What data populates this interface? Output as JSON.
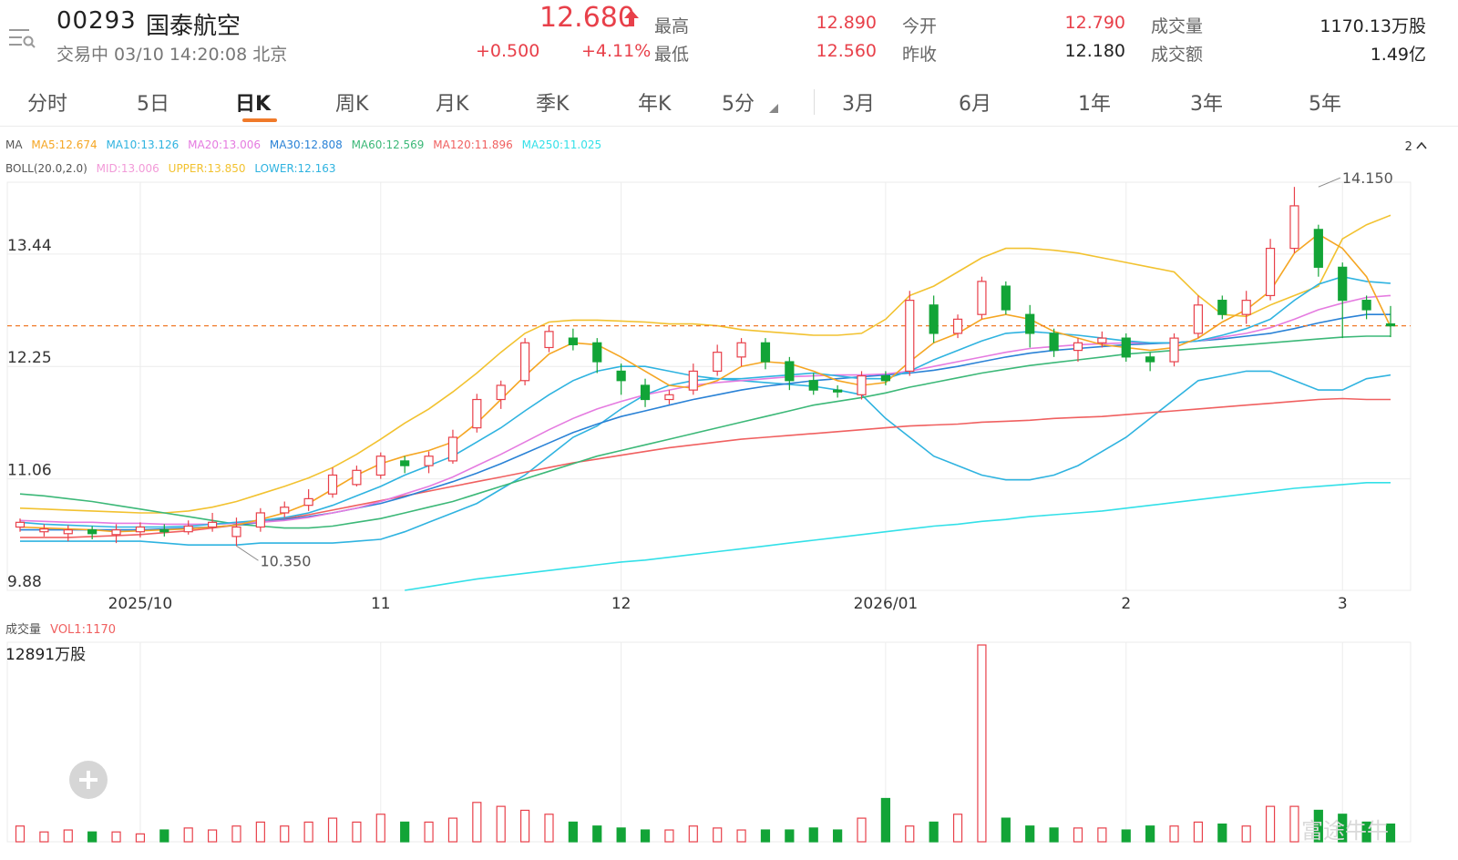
{
  "header": {
    "code": "00293",
    "name": "国泰航空",
    "status": "交易中 03/10 14:20:08 北京",
    "price": "12.680",
    "change": "+0.500",
    "change_pct": "+4.11%",
    "stats": [
      {
        "label": "最高",
        "value": "12.890",
        "color": "red"
      },
      {
        "label": "最低",
        "value": "12.560",
        "color": "red"
      },
      {
        "label": "今开",
        "value": "12.790",
        "color": "red"
      },
      {
        "label": "昨收",
        "value": "12.180",
        "color": "dark"
      },
      {
        "label": "成交量",
        "value": "1170.13万股",
        "color": "dark"
      },
      {
        "label": "成交额",
        "value": "1.49亿",
        "color": "dark"
      }
    ]
  },
  "tabs": [
    "分时",
    "5日",
    "日K",
    "周K",
    "月K",
    "季K",
    "年K",
    "5分",
    "3月",
    "6月",
    "1年",
    "3年",
    "5年"
  ],
  "active_tab": "日K",
  "ma_legend": {
    "prefix": "MA",
    "items": [
      {
        "text": "MA5:12.674",
        "color": "#f5a623"
      },
      {
        "text": "MA10:13.126",
        "color": "#2fb3e0"
      },
      {
        "text": "MA20:13.006",
        "color": "#e57be0"
      },
      {
        "text": "MA30:12.808",
        "color": "#2a82d6"
      },
      {
        "text": "MA60:12.569",
        "color": "#3cb878"
      },
      {
        "text": "MA120:11.896",
        "color": "#f06060"
      },
      {
        "text": "MA250:11.025",
        "color": "#33e0e8"
      }
    ]
  },
  "boll_legend": {
    "prefix": "BOLL(20.0,2.0)",
    "items": [
      {
        "text": "MID:13.006",
        "color": "#f29ad8"
      },
      {
        "text": "UPPER:13.850",
        "color": "#f2c230"
      },
      {
        "text": "LOWER:12.163",
        "color": "#2fb3e0"
      }
    ]
  },
  "collapse_label": "2",
  "vol_legend": {
    "label": "成交量",
    "value": "VOL1:1170"
  },
  "vol_max_label": "12891万股",
  "watermark": "富途牛牛",
  "colors": {
    "up": "#e8404a",
    "down": "#12a437",
    "accent": "#f07a2a"
  },
  "chart_data": {
    "type": "candlestick",
    "y_ticks": [
      "13.44",
      "12.25",
      "11.06",
      "9.88"
    ],
    "ylim": [
      9.88,
      14.2
    ],
    "x_ticks": [
      {
        "label": "2025/10",
        "index": 5
      },
      {
        "label": "11",
        "index": 15
      },
      {
        "label": "12",
        "index": 25
      },
      {
        "label": "2026/01",
        "index": 36
      },
      {
        "label": "2",
        "index": 46
      },
      {
        "label": "3",
        "index": 55
      }
    ],
    "current_price": 12.68,
    "high_annotation": {
      "label": "14.150",
      "index": 54,
      "value": 14.15
    },
    "low_annotation": {
      "label": "10.350",
      "index": 9,
      "value": 10.35
    },
    "candles": [
      [
        10.55,
        10.6,
        10.64,
        10.5
      ],
      [
        10.5,
        10.53,
        10.58,
        10.45
      ],
      [
        10.48,
        10.52,
        10.57,
        10.4
      ],
      [
        10.52,
        10.48,
        10.56,
        10.42
      ],
      [
        10.47,
        10.52,
        10.58,
        10.38
      ],
      [
        10.5,
        10.55,
        10.6,
        10.44
      ],
      [
        10.52,
        10.5,
        10.58,
        10.45
      ],
      [
        10.5,
        10.56,
        10.62,
        10.47
      ],
      [
        10.55,
        10.6,
        10.7,
        10.5
      ],
      [
        10.45,
        10.55,
        10.65,
        10.35
      ],
      [
        10.55,
        10.7,
        10.75,
        10.5
      ],
      [
        10.7,
        10.76,
        10.82,
        10.65
      ],
      [
        10.78,
        10.85,
        10.95,
        10.72
      ],
      [
        10.9,
        11.1,
        11.18,
        10.86
      ],
      [
        11.0,
        11.15,
        11.2,
        10.98
      ],
      [
        11.1,
        11.3,
        11.34,
        11.06
      ],
      [
        11.25,
        11.2,
        11.3,
        11.12
      ],
      [
        11.2,
        11.3,
        11.35,
        11.12
      ],
      [
        11.25,
        11.5,
        11.58,
        11.22
      ],
      [
        11.6,
        11.9,
        11.96,
        11.55
      ],
      [
        11.9,
        12.05,
        12.1,
        11.8
      ],
      [
        12.1,
        12.5,
        12.55,
        12.05
      ],
      [
        12.45,
        12.62,
        12.68,
        12.4
      ],
      [
        12.55,
        12.48,
        12.65,
        12.42
      ],
      [
        12.5,
        12.3,
        12.55,
        12.18
      ],
      [
        12.2,
        12.1,
        12.28,
        11.95
      ],
      [
        12.05,
        11.9,
        12.12,
        11.82
      ],
      [
        11.9,
        11.95,
        12.0,
        11.85
      ],
      [
        12.0,
        12.2,
        12.28,
        11.95
      ],
      [
        12.2,
        12.4,
        12.48,
        12.15
      ],
      [
        12.35,
        12.5,
        12.55,
        12.25
      ],
      [
        12.5,
        12.3,
        12.55,
        12.22
      ],
      [
        12.3,
        12.1,
        12.35,
        12.0
      ],
      [
        12.1,
        12.0,
        12.18,
        11.95
      ],
      [
        12.0,
        11.98,
        12.05,
        11.92
      ],
      [
        11.95,
        12.15,
        12.2,
        11.9
      ],
      [
        12.15,
        12.1,
        12.2,
        12.05
      ],
      [
        12.2,
        12.95,
        13.05,
        12.15
      ],
      [
        12.9,
        12.6,
        13.0,
        12.5
      ],
      [
        12.6,
        12.75,
        12.8,
        12.55
      ],
      [
        12.8,
        13.15,
        13.2,
        12.75
      ],
      [
        13.1,
        12.85,
        13.15,
        12.8
      ],
      [
        12.8,
        12.6,
        12.9,
        12.45
      ],
      [
        12.6,
        12.42,
        12.65,
        12.35
      ],
      [
        12.42,
        12.5,
        12.55,
        12.3
      ],
      [
        12.5,
        12.55,
        12.62,
        12.45
      ],
      [
        12.55,
        12.35,
        12.6,
        12.3
      ],
      [
        12.35,
        12.3,
        12.4,
        12.2
      ],
      [
        12.3,
        12.55,
        12.6,
        12.25
      ],
      [
        12.6,
        12.9,
        13.0,
        12.55
      ],
      [
        12.95,
        12.8,
        13.0,
        12.75
      ],
      [
        12.8,
        12.95,
        13.05,
        12.7
      ],
      [
        13.0,
        13.5,
        13.6,
        12.95
      ],
      [
        13.5,
        13.95,
        14.15,
        13.45
      ],
      [
        13.7,
        13.3,
        13.75,
        13.2
      ],
      [
        13.3,
        12.95,
        13.35,
        12.55
      ],
      [
        12.95,
        12.85,
        13.0,
        12.75
      ],
      [
        12.7,
        12.68,
        12.89,
        12.56
      ]
    ],
    "ma5": [
      10.55,
      10.54,
      10.53,
      10.52,
      10.5,
      10.51,
      10.52,
      10.53,
      10.55,
      10.57,
      10.63,
      10.7,
      10.8,
      10.95,
      11.1,
      11.22,
      11.3,
      11.36,
      11.45,
      11.65,
      11.9,
      12.15,
      12.38,
      12.5,
      12.48,
      12.35,
      12.2,
      12.05,
      12.02,
      12.1,
      12.25,
      12.3,
      12.28,
      12.2,
      12.1,
      12.05,
      12.08,
      12.3,
      12.5,
      12.6,
      12.75,
      12.8,
      12.75,
      12.62,
      12.55,
      12.48,
      12.45,
      12.42,
      12.45,
      12.55,
      12.72,
      12.85,
      13.05,
      13.45,
      13.65,
      13.5,
      13.2,
      12.67
    ],
    "ma10": [
      10.6,
      10.58,
      10.57,
      10.56,
      10.55,
      10.55,
      10.55,
      10.56,
      10.58,
      10.6,
      10.62,
      10.65,
      10.7,
      10.78,
      10.88,
      10.98,
      11.1,
      11.2,
      11.3,
      11.45,
      11.6,
      11.78,
      11.95,
      12.1,
      12.2,
      12.25,
      12.25,
      12.2,
      12.15,
      12.12,
      12.12,
      12.14,
      12.16,
      12.18,
      12.15,
      12.12,
      12.12,
      12.2,
      12.32,
      12.42,
      12.52,
      12.6,
      12.62,
      12.6,
      12.58,
      12.55,
      12.52,
      12.5,
      12.5,
      12.52,
      12.58,
      12.65,
      12.75,
      12.95,
      13.12,
      13.2,
      13.15,
      13.13
    ],
    "ma20": [
      10.62,
      10.61,
      10.6,
      10.6,
      10.59,
      10.59,
      10.58,
      10.58,
      10.58,
      10.59,
      10.6,
      10.62,
      10.65,
      10.7,
      10.75,
      10.82,
      10.9,
      10.98,
      11.08,
      11.2,
      11.32,
      11.45,
      11.58,
      11.7,
      11.8,
      11.88,
      11.95,
      12.0,
      12.05,
      12.08,
      12.1,
      12.12,
      12.14,
      12.15,
      12.16,
      12.16,
      12.17,
      12.2,
      12.25,
      12.3,
      12.35,
      12.4,
      12.44,
      12.46,
      12.48,
      12.49,
      12.5,
      12.5,
      12.5,
      12.52,
      12.56,
      12.6,
      12.66,
      12.75,
      12.85,
      12.92,
      12.98,
      13.0
    ],
    "ma30": [
      10.52,
      10.52,
      10.52,
      10.52,
      10.52,
      10.52,
      10.53,
      10.54,
      10.55,
      10.57,
      10.6,
      10.63,
      10.66,
      10.7,
      10.75,
      10.8,
      10.87,
      10.95,
      11.03,
      11.12,
      11.22,
      11.33,
      11.44,
      11.55,
      11.64,
      11.72,
      11.78,
      11.84,
      11.9,
      11.95,
      12.0,
      12.04,
      12.07,
      12.1,
      12.12,
      12.14,
      12.16,
      12.18,
      12.21,
      12.25,
      12.3,
      12.35,
      12.39,
      12.42,
      12.44,
      12.46,
      12.48,
      12.49,
      12.5,
      12.52,
      12.54,
      12.57,
      12.6,
      12.65,
      12.71,
      12.76,
      12.8,
      12.8
    ],
    "ma60": [
      10.9,
      10.88,
      10.85,
      10.82,
      10.78,
      10.74,
      10.7,
      10.66,
      10.62,
      10.58,
      10.56,
      10.54,
      10.54,
      10.56,
      10.6,
      10.64,
      10.7,
      10.76,
      10.82,
      10.9,
      10.98,
      11.06,
      11.14,
      11.22,
      11.3,
      11.36,
      11.42,
      11.48,
      11.54,
      11.6,
      11.66,
      11.72,
      11.78,
      11.84,
      11.88,
      11.92,
      11.97,
      12.03,
      12.08,
      12.13,
      12.18,
      12.22,
      12.26,
      12.29,
      12.32,
      12.35,
      12.38,
      12.4,
      12.42,
      12.44,
      12.46,
      12.48,
      12.5,
      12.52,
      12.54,
      12.56,
      12.57,
      12.57
    ],
    "ma120": [
      10.44,
      10.44,
      10.44,
      10.45,
      10.46,
      10.47,
      10.49,
      10.51,
      10.54,
      10.57,
      10.6,
      10.64,
      10.68,
      10.73,
      10.78,
      10.83,
      10.88,
      10.93,
      10.98,
      11.03,
      11.08,
      11.13,
      11.18,
      11.23,
      11.27,
      11.31,
      11.35,
      11.39,
      11.42,
      11.45,
      11.48,
      11.5,
      11.52,
      11.54,
      11.56,
      11.58,
      11.6,
      11.62,
      11.63,
      11.64,
      11.66,
      11.67,
      11.68,
      11.7,
      11.71,
      11.72,
      11.74,
      11.76,
      11.78,
      11.8,
      11.82,
      11.84,
      11.86,
      11.88,
      11.9,
      11.91,
      11.9,
      11.9
    ],
    "ma250": [
      null,
      null,
      null,
      null,
      null,
      null,
      null,
      null,
      null,
      null,
      null,
      null,
      null,
      null,
      null,
      null,
      9.88,
      9.92,
      9.96,
      10.0,
      10.03,
      10.06,
      10.09,
      10.12,
      10.15,
      10.18,
      10.2,
      10.23,
      10.26,
      10.29,
      10.32,
      10.35,
      10.38,
      10.41,
      10.44,
      10.47,
      10.5,
      10.53,
      10.56,
      10.58,
      10.61,
      10.63,
      10.66,
      10.68,
      10.7,
      10.72,
      10.75,
      10.78,
      10.81,
      10.84,
      10.87,
      10.9,
      10.93,
      10.96,
      10.98,
      11.0,
      11.02,
      11.02
    ],
    "boll_upper": [
      10.75,
      10.74,
      10.73,
      10.72,
      10.71,
      10.7,
      10.7,
      10.72,
      10.76,
      10.82,
      10.9,
      10.98,
      11.07,
      11.18,
      11.32,
      11.48,
      11.65,
      11.8,
      11.98,
      12.18,
      12.4,
      12.6,
      12.72,
      12.74,
      12.74,
      12.73,
      12.72,
      12.7,
      12.7,
      12.68,
      12.64,
      12.62,
      12.6,
      12.58,
      12.58,
      12.6,
      12.75,
      13.0,
      13.1,
      13.25,
      13.4,
      13.5,
      13.5,
      13.48,
      13.45,
      13.4,
      13.35,
      13.3,
      13.25,
      13.0,
      12.8,
      12.78,
      12.9,
      13.0,
      13.1,
      13.6,
      13.75,
      13.85
    ],
    "boll_lower": [
      10.4,
      10.4,
      10.4,
      10.4,
      10.4,
      10.4,
      10.38,
      10.36,
      10.36,
      10.36,
      10.38,
      10.38,
      10.38,
      10.38,
      10.4,
      10.42,
      10.5,
      10.6,
      10.7,
      10.8,
      10.95,
      11.1,
      11.3,
      11.5,
      11.62,
      11.8,
      11.95,
      12.05,
      12.1,
      12.12,
      12.1,
      12.08,
      12.06,
      12.04,
      12.0,
      11.95,
      11.7,
      11.5,
      11.3,
      11.2,
      11.1,
      11.05,
      11.05,
      11.1,
      11.2,
      11.35,
      11.5,
      11.7,
      11.9,
      12.1,
      12.15,
      12.2,
      12.2,
      12.1,
      12.0,
      12.0,
      12.12,
      12.16
    ],
    "volume": [
      0.08,
      0.05,
      0.06,
      0.05,
      0.05,
      0.04,
      0.06,
      0.07,
      0.06,
      0.08,
      0.1,
      0.08,
      0.1,
      0.12,
      0.1,
      0.14,
      0.1,
      0.1,
      0.12,
      0.2,
      0.18,
      0.16,
      0.14,
      0.1,
      0.08,
      0.07,
      0.06,
      0.06,
      0.08,
      0.07,
      0.06,
      0.06,
      0.06,
      0.07,
      0.06,
      0.12,
      0.22,
      0.08,
      0.1,
      0.14,
      1.0,
      0.12,
      0.08,
      0.07,
      0.07,
      0.07,
      0.06,
      0.08,
      0.08,
      0.1,
      0.09,
      0.08,
      0.18,
      0.18,
      0.16,
      0.14,
      0.1,
      0.09
    ]
  }
}
